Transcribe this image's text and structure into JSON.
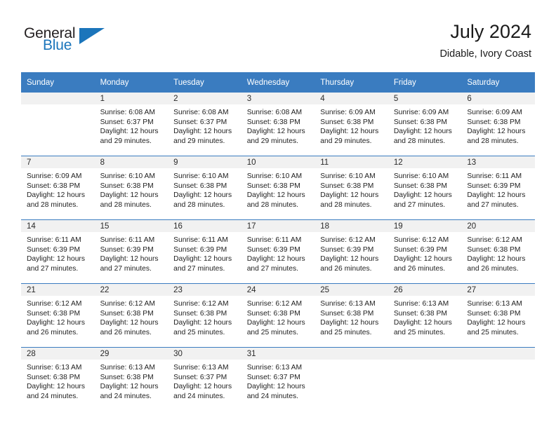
{
  "logo": {
    "word_top": "General",
    "word_bottom": "Blue",
    "triangle_color": "#1b75bb",
    "text_color": "#231f20"
  },
  "header": {
    "title": "July 2024",
    "subtitle": "Didable, Ivory Coast"
  },
  "theme": {
    "header_row_bg": "#3a7cc0",
    "daynum_band_bg": "#f1f1f1",
    "grid_line": "#3a7cc0"
  },
  "weekday_headers": [
    "Sunday",
    "Monday",
    "Tuesday",
    "Wednesday",
    "Thursday",
    "Friday",
    "Saturday"
  ],
  "weeks": [
    [
      {
        "day": "",
        "sunrise": "",
        "sunset": "",
        "daylight_line1": "",
        "daylight_line2": ""
      },
      {
        "day": "1",
        "sunrise": "Sunrise: 6:08 AM",
        "sunset": "Sunset: 6:37 PM",
        "daylight_line1": "Daylight: 12 hours",
        "daylight_line2": "and 29 minutes."
      },
      {
        "day": "2",
        "sunrise": "Sunrise: 6:08 AM",
        "sunset": "Sunset: 6:37 PM",
        "daylight_line1": "Daylight: 12 hours",
        "daylight_line2": "and 29 minutes."
      },
      {
        "day": "3",
        "sunrise": "Sunrise: 6:08 AM",
        "sunset": "Sunset: 6:38 PM",
        "daylight_line1": "Daylight: 12 hours",
        "daylight_line2": "and 29 minutes."
      },
      {
        "day": "4",
        "sunrise": "Sunrise: 6:09 AM",
        "sunset": "Sunset: 6:38 PM",
        "daylight_line1": "Daylight: 12 hours",
        "daylight_line2": "and 29 minutes."
      },
      {
        "day": "5",
        "sunrise": "Sunrise: 6:09 AM",
        "sunset": "Sunset: 6:38 PM",
        "daylight_line1": "Daylight: 12 hours",
        "daylight_line2": "and 28 minutes."
      },
      {
        "day": "6",
        "sunrise": "Sunrise: 6:09 AM",
        "sunset": "Sunset: 6:38 PM",
        "daylight_line1": "Daylight: 12 hours",
        "daylight_line2": "and 28 minutes."
      }
    ],
    [
      {
        "day": "7",
        "sunrise": "Sunrise: 6:09 AM",
        "sunset": "Sunset: 6:38 PM",
        "daylight_line1": "Daylight: 12 hours",
        "daylight_line2": "and 28 minutes."
      },
      {
        "day": "8",
        "sunrise": "Sunrise: 6:10 AM",
        "sunset": "Sunset: 6:38 PM",
        "daylight_line1": "Daylight: 12 hours",
        "daylight_line2": "and 28 minutes."
      },
      {
        "day": "9",
        "sunrise": "Sunrise: 6:10 AM",
        "sunset": "Sunset: 6:38 PM",
        "daylight_line1": "Daylight: 12 hours",
        "daylight_line2": "and 28 minutes."
      },
      {
        "day": "10",
        "sunrise": "Sunrise: 6:10 AM",
        "sunset": "Sunset: 6:38 PM",
        "daylight_line1": "Daylight: 12 hours",
        "daylight_line2": "and 28 minutes."
      },
      {
        "day": "11",
        "sunrise": "Sunrise: 6:10 AM",
        "sunset": "Sunset: 6:38 PM",
        "daylight_line1": "Daylight: 12 hours",
        "daylight_line2": "and 28 minutes."
      },
      {
        "day": "12",
        "sunrise": "Sunrise: 6:10 AM",
        "sunset": "Sunset: 6:38 PM",
        "daylight_line1": "Daylight: 12 hours",
        "daylight_line2": "and 27 minutes."
      },
      {
        "day": "13",
        "sunrise": "Sunrise: 6:11 AM",
        "sunset": "Sunset: 6:39 PM",
        "daylight_line1": "Daylight: 12 hours",
        "daylight_line2": "and 27 minutes."
      }
    ],
    [
      {
        "day": "14",
        "sunrise": "Sunrise: 6:11 AM",
        "sunset": "Sunset: 6:39 PM",
        "daylight_line1": "Daylight: 12 hours",
        "daylight_line2": "and 27 minutes."
      },
      {
        "day": "15",
        "sunrise": "Sunrise: 6:11 AM",
        "sunset": "Sunset: 6:39 PM",
        "daylight_line1": "Daylight: 12 hours",
        "daylight_line2": "and 27 minutes."
      },
      {
        "day": "16",
        "sunrise": "Sunrise: 6:11 AM",
        "sunset": "Sunset: 6:39 PM",
        "daylight_line1": "Daylight: 12 hours",
        "daylight_line2": "and 27 minutes."
      },
      {
        "day": "17",
        "sunrise": "Sunrise: 6:11 AM",
        "sunset": "Sunset: 6:39 PM",
        "daylight_line1": "Daylight: 12 hours",
        "daylight_line2": "and 27 minutes."
      },
      {
        "day": "18",
        "sunrise": "Sunrise: 6:12 AM",
        "sunset": "Sunset: 6:39 PM",
        "daylight_line1": "Daylight: 12 hours",
        "daylight_line2": "and 26 minutes."
      },
      {
        "day": "19",
        "sunrise": "Sunrise: 6:12 AM",
        "sunset": "Sunset: 6:39 PM",
        "daylight_line1": "Daylight: 12 hours",
        "daylight_line2": "and 26 minutes."
      },
      {
        "day": "20",
        "sunrise": "Sunrise: 6:12 AM",
        "sunset": "Sunset: 6:38 PM",
        "daylight_line1": "Daylight: 12 hours",
        "daylight_line2": "and 26 minutes."
      }
    ],
    [
      {
        "day": "21",
        "sunrise": "Sunrise: 6:12 AM",
        "sunset": "Sunset: 6:38 PM",
        "daylight_line1": "Daylight: 12 hours",
        "daylight_line2": "and 26 minutes."
      },
      {
        "day": "22",
        "sunrise": "Sunrise: 6:12 AM",
        "sunset": "Sunset: 6:38 PM",
        "daylight_line1": "Daylight: 12 hours",
        "daylight_line2": "and 26 minutes."
      },
      {
        "day": "23",
        "sunrise": "Sunrise: 6:12 AM",
        "sunset": "Sunset: 6:38 PM",
        "daylight_line1": "Daylight: 12 hours",
        "daylight_line2": "and 25 minutes."
      },
      {
        "day": "24",
        "sunrise": "Sunrise: 6:12 AM",
        "sunset": "Sunset: 6:38 PM",
        "daylight_line1": "Daylight: 12 hours",
        "daylight_line2": "and 25 minutes."
      },
      {
        "day": "25",
        "sunrise": "Sunrise: 6:13 AM",
        "sunset": "Sunset: 6:38 PM",
        "daylight_line1": "Daylight: 12 hours",
        "daylight_line2": "and 25 minutes."
      },
      {
        "day": "26",
        "sunrise": "Sunrise: 6:13 AM",
        "sunset": "Sunset: 6:38 PM",
        "daylight_line1": "Daylight: 12 hours",
        "daylight_line2": "and 25 minutes."
      },
      {
        "day": "27",
        "sunrise": "Sunrise: 6:13 AM",
        "sunset": "Sunset: 6:38 PM",
        "daylight_line1": "Daylight: 12 hours",
        "daylight_line2": "and 25 minutes."
      }
    ],
    [
      {
        "day": "28",
        "sunrise": "Sunrise: 6:13 AM",
        "sunset": "Sunset: 6:38 PM",
        "daylight_line1": "Daylight: 12 hours",
        "daylight_line2": "and 24 minutes."
      },
      {
        "day": "29",
        "sunrise": "Sunrise: 6:13 AM",
        "sunset": "Sunset: 6:38 PM",
        "daylight_line1": "Daylight: 12 hours",
        "daylight_line2": "and 24 minutes."
      },
      {
        "day": "30",
        "sunrise": "Sunrise: 6:13 AM",
        "sunset": "Sunset: 6:37 PM",
        "daylight_line1": "Daylight: 12 hours",
        "daylight_line2": "and 24 minutes."
      },
      {
        "day": "31",
        "sunrise": "Sunrise: 6:13 AM",
        "sunset": "Sunset: 6:37 PM",
        "daylight_line1": "Daylight: 12 hours",
        "daylight_line2": "and 24 minutes."
      },
      {
        "day": "",
        "sunrise": "",
        "sunset": "",
        "daylight_line1": "",
        "daylight_line2": ""
      },
      {
        "day": "",
        "sunrise": "",
        "sunset": "",
        "daylight_line1": "",
        "daylight_line2": ""
      },
      {
        "day": "",
        "sunrise": "",
        "sunset": "",
        "daylight_line1": "",
        "daylight_line2": ""
      }
    ]
  ]
}
